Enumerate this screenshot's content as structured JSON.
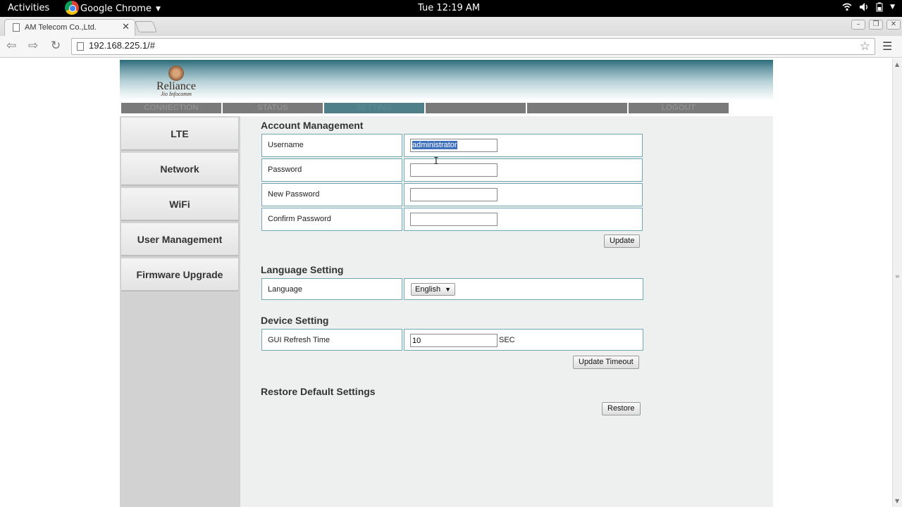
{
  "os_bar": {
    "activities": "Activities",
    "app_name": "Google Chrome",
    "clock": "Tue 12:19 AM"
  },
  "browser": {
    "tab_title": "AM Telecom Co.,Ltd.",
    "url": "192.168.225.1/#"
  },
  "brand": {
    "name": "Reliance",
    "sub": "Jio Infocomm"
  },
  "topnav": [
    "CONNECTION",
    "STATUS",
    "SETTING",
    "",
    "",
    "LOGOUT"
  ],
  "topnav_active": "SETTING",
  "sidebar": [
    "LTE",
    "Network",
    "WiFi",
    "User Management",
    "Firmware Upgrade"
  ],
  "account": {
    "title": "Account Management",
    "username_label": "Username",
    "username_value": "administrator",
    "password_label": "Password",
    "new_password_label": "New Password",
    "confirm_password_label": "Confirm Password",
    "update_button": "Update"
  },
  "language": {
    "title": "Language Setting",
    "label": "Language",
    "selected": "English"
  },
  "device": {
    "title": "Device Setting",
    "label": "GUI Refresh Time",
    "value": "10",
    "unit": "SEC",
    "button": "Update Timeout"
  },
  "restore": {
    "title": "Restore Default Settings",
    "button": "Restore"
  },
  "colors": {
    "accent": "#6fa8b3",
    "nav_active": "#4f7f89",
    "nav_bg": "#7a7a7a"
  }
}
